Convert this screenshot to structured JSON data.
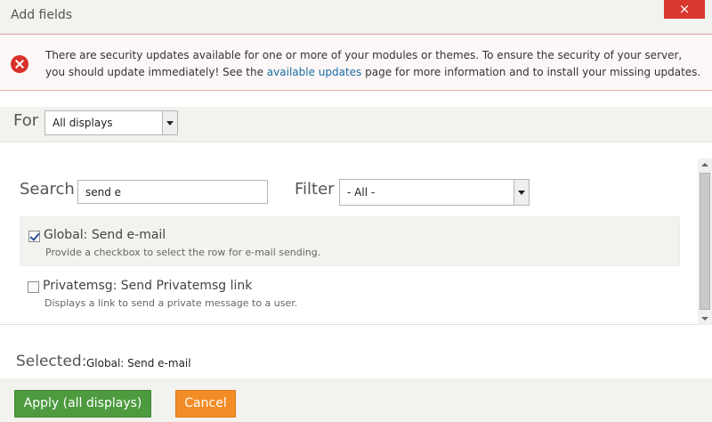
{
  "dialog": {
    "title": "Add fields",
    "close_label": "×"
  },
  "alert": {
    "text_before": "There are security updates available for one or more of your modules or themes. To ensure the security of your server, you should update immediately! See the ",
    "link_text": "available updates",
    "text_after": " page for more information and to install your missing updates."
  },
  "for": {
    "label": "For",
    "selected": "All displays"
  },
  "search": {
    "label": "Search",
    "value": "send e"
  },
  "filter": {
    "label": "Filter",
    "selected": "- All -"
  },
  "fields": [
    {
      "title": "Global: Send e-mail",
      "description": "Provide a checkbox to select the row for e-mail sending.",
      "checked": true
    },
    {
      "title": "Privatemsg: Send Privatemsg link",
      "description": "Displays a link to send a private message to a user.",
      "checked": false
    }
  ],
  "selected": {
    "label": "Selected:",
    "value": "Global: Send e-mail"
  },
  "buttons": {
    "apply": "Apply (all displays)",
    "cancel": "Cancel"
  },
  "colors": {
    "apply": "#4d9a3f",
    "cancel": "#f28c26",
    "close": "#d9382f",
    "error": "#d9312b",
    "link": "#1a6da3"
  }
}
